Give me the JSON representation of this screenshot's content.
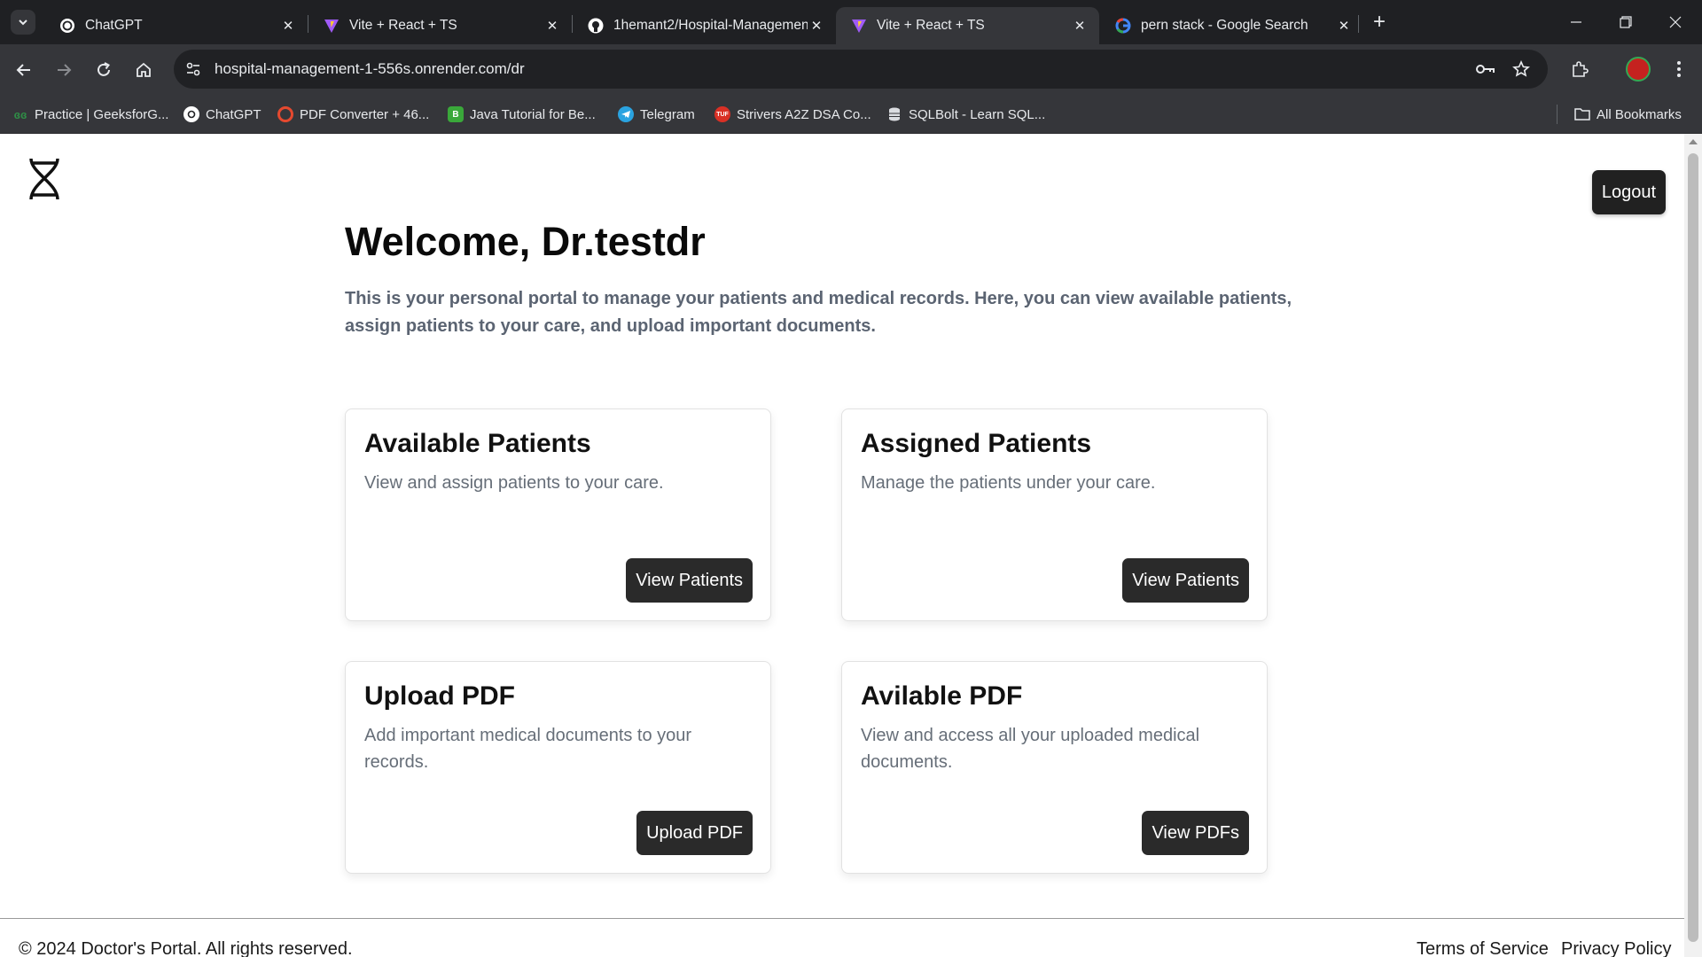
{
  "browser": {
    "tabs": [
      {
        "title": "ChatGPT",
        "icon": "chatgpt-icon"
      },
      {
        "title": "Vite + React + TS",
        "icon": "vite-icon"
      },
      {
        "title": "1hemant2/Hospital-Management",
        "icon": "github-icon"
      },
      {
        "title": "Vite + React + TS",
        "icon": "vite-icon"
      },
      {
        "title": "pern stack - Google Search",
        "icon": "google-icon"
      }
    ],
    "active_tab_index": 3,
    "url": "hospital-management-1-556s.onrender.com/dr",
    "bookmarks": [
      {
        "label": "Practice | GeeksforG...",
        "icon": "geeksforgeeks-icon",
        "color": "#2f8d46"
      },
      {
        "label": "ChatGPT",
        "icon": "chatgpt-icon",
        "color": "#e8eaed"
      },
      {
        "label": "PDF Converter + 46...",
        "icon": "pdf-converter-icon",
        "color": "#e5492f"
      },
      {
        "label": "Java Tutorial for Be...",
        "icon": "java-tutorial-icon",
        "color": "#3aa83a"
      },
      {
        "label": "Telegram",
        "icon": "telegram-icon",
        "color": "#2aa3e0"
      },
      {
        "label": "Strivers A2Z DSA Co...",
        "icon": "striver-icon",
        "color": "#d93025",
        "icon_text": "TUF"
      },
      {
        "label": "SQLBolt - Learn SQL...",
        "icon": "sqlbolt-icon",
        "color": "#dadce0"
      }
    ],
    "all_bookmarks_label": "All Bookmarks"
  },
  "page": {
    "logout_label": "Logout",
    "welcome": "Welcome, Dr.testdr",
    "intro": "This is your personal portal to manage your patients and medical records. Here, you can view available patients, assign patients to your care, and upload important documents.",
    "cards": [
      {
        "title": "Available Patients",
        "description": "View and assign patients to your care.",
        "button": "View Patients"
      },
      {
        "title": "Assigned Patients",
        "description": "Manage the patients under your care.",
        "button": "View Patients"
      },
      {
        "title": "Upload PDF",
        "description": "Add important medical documents to your records.",
        "button": "Upload PDF"
      },
      {
        "title": "Avilable PDF",
        "description": "View and access all your uploaded medical documents.",
        "button": "View PDFs"
      }
    ],
    "footer": {
      "copyright": "© 2024 Doctor's Portal. All rights reserved.",
      "terms": "Terms of Service",
      "privacy": "Privacy Policy"
    }
  },
  "colors": {
    "button_dark": "#2a2a2a",
    "intro_text": "#5b6472",
    "browser_chrome": "#35363a"
  }
}
